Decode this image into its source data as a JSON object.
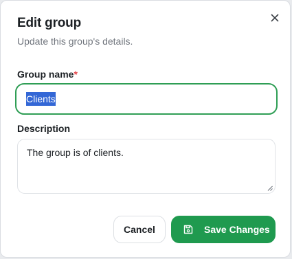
{
  "dialog": {
    "title": "Edit group",
    "subtitle": "Update this group's details.",
    "close_icon": "close-icon"
  },
  "form": {
    "name_label": "Group name",
    "required_marker": "*",
    "name_value": "Clients",
    "description_label": "Description",
    "description_value": "The group is of clients."
  },
  "actions": {
    "cancel_label": "Cancel",
    "save_label": "Save Changes",
    "save_icon": "floppy-disk-icon"
  },
  "colors": {
    "accent_green": "#1f9a4f",
    "focus_border": "#2f9e55",
    "required_red": "#e5484d",
    "selection_blue": "#3367d6"
  }
}
